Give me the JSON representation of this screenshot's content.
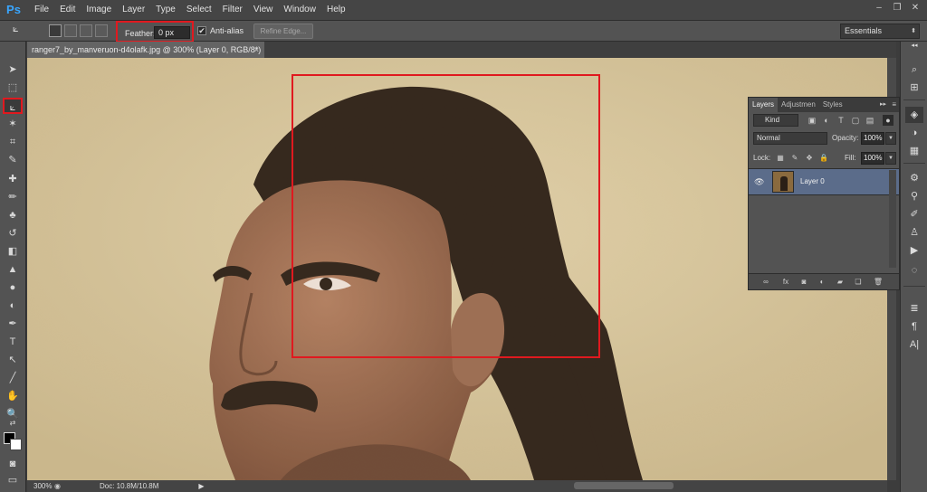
{
  "app": {
    "logo": "Ps",
    "menu": [
      "File",
      "Edit",
      "Image",
      "Layer",
      "Type",
      "Select",
      "Filter",
      "View",
      "Window",
      "Help"
    ],
    "window_controls": {
      "minimize": "–",
      "restore": "❐",
      "close": "✕"
    }
  },
  "options_bar": {
    "feather_label": "Feather:",
    "feather_value": "0 px",
    "antialias_checked": "✔",
    "antialias_label": "Anti-alias",
    "refine_edge_label": "Refine Edge...",
    "workspace_label": "Essentials",
    "workspace_arrow": "⬍"
  },
  "document": {
    "tab_title": "ranger7_by_manveruon-d4olafk.jpg @ 300% (Layer 0, RGB/8*)",
    "tab_close": "×"
  },
  "status_bar": {
    "zoom": "300%",
    "doc_info": "Doc: 10.8M/10.8M",
    "arrow": "▶"
  },
  "layers_panel": {
    "tabs": [
      "Layers",
      "Adjustmen",
      "Styles"
    ],
    "collapse_glyph": "▸▸",
    "menu_glyph": "≡",
    "kind_label": "Kind",
    "blend_mode": "Normal",
    "opacity_label": "Opacity:",
    "opacity_value": "100%",
    "lock_label": "Lock:",
    "fill_label": "Fill:",
    "fill_value": "100%",
    "layer_name": "Layer 0",
    "visibility_glyph": "👁"
  },
  "tools": [
    {
      "glyph": "➤"
    },
    {
      "glyph": "⬚"
    },
    {
      "glyph": "⟀"
    },
    {
      "glyph": "✶"
    },
    {
      "glyph": "⌗"
    },
    {
      "glyph": "✎"
    },
    {
      "glyph": "✚"
    },
    {
      "glyph": "✏"
    },
    {
      "glyph": "♣"
    },
    {
      "glyph": "↺"
    },
    {
      "glyph": "◧"
    },
    {
      "glyph": "▲"
    },
    {
      "glyph": "●"
    },
    {
      "glyph": "◐"
    },
    {
      "glyph": "✒"
    },
    {
      "glyph": "T"
    },
    {
      "glyph": "↖"
    },
    {
      "glyph": "╱"
    },
    {
      "glyph": "✋"
    },
    {
      "glyph": "🔍"
    },
    {
      "glyph": "⇄"
    }
  ],
  "colors": {
    "highlight": "#e0191f",
    "foreground": "#000000",
    "background": "#ffffff",
    "layer_selected": "#5b6c8a"
  }
}
